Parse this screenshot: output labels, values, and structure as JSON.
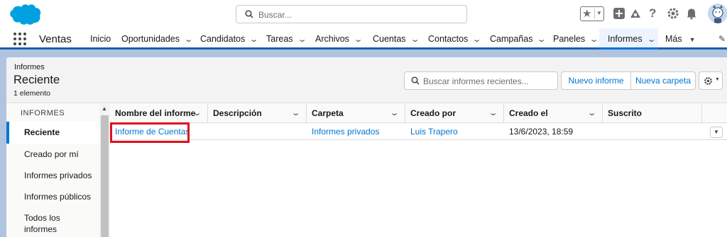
{
  "header": {
    "search_placeholder": "Buscar...",
    "brand_color": "#00a1e0"
  },
  "nav": {
    "app_name": "Ventas",
    "items": [
      {
        "label": "Inicio",
        "chevron": false
      },
      {
        "label": "Oportunidades",
        "chevron": true
      },
      {
        "label": "Candidatos",
        "chevron": true
      },
      {
        "label": "Tareas",
        "chevron": true
      },
      {
        "label": "Archivos",
        "chevron": true
      },
      {
        "label": "Cuentas",
        "chevron": true
      },
      {
        "label": "Contactos",
        "chevron": true
      },
      {
        "label": "Campañas",
        "chevron": true
      },
      {
        "label": "Paneles",
        "chevron": true
      },
      {
        "label": "Informes",
        "chevron": true,
        "active": true
      },
      {
        "label": "Más",
        "chevron": "caret"
      }
    ]
  },
  "page": {
    "breadcrumb": "Informes",
    "title": "Reciente",
    "count": "1 elemento",
    "search_placeholder": "Buscar informes recientes...",
    "new_report": "Nuevo informe",
    "new_folder": "Nueva carpeta"
  },
  "sidebar": {
    "header": "INFORMES",
    "items": [
      {
        "label": "Reciente",
        "active": true
      },
      {
        "label": "Creado por mí"
      },
      {
        "label": "Informes privados"
      },
      {
        "label": "Informes públicos"
      },
      {
        "label": "Todos los informes"
      }
    ]
  },
  "table": {
    "columns": [
      "Nombre del informe",
      "Descripción",
      "Carpeta",
      "Creado por",
      "Creado el",
      "Suscrito"
    ],
    "rows": [
      {
        "name": "Informe de Cuentas",
        "description": "",
        "folder": "Informes privados",
        "created_by": "Luis Trapero",
        "created_on": "13/6/2023, 18:59",
        "subscribed": ""
      }
    ]
  },
  "colors": {
    "accent": "#0176d3",
    "highlight": "#e0101e",
    "nav_border": "#1b5fa8"
  }
}
